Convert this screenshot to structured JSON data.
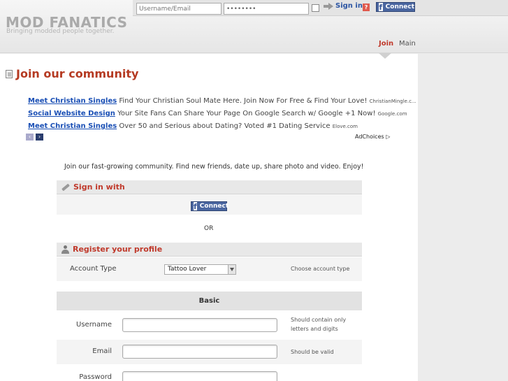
{
  "site": {
    "logo": "MOD FANATICS",
    "tagline": "Bringing modded people together."
  },
  "login": {
    "username_placeholder": "Username/Email",
    "password_value": "••••••••",
    "signin_label": "Sign in",
    "help_label": "?",
    "connect_label": "Connect"
  },
  "nav": {
    "join": "Join",
    "main": "Main"
  },
  "page": {
    "title": "Join our community"
  },
  "ads": [
    {
      "link": "Meet Christian Singles",
      "text": "Find Your Christian Soul Mate Here. Join Now For Free & Find Your Love!",
      "domain": "ChristianMingle.c..."
    },
    {
      "link": "Social Website Design",
      "text": "Your Site Fans Can Share Your Page On Google Search w/ Google +1 Now!",
      "domain": "Google.com"
    },
    {
      "link": "Meet Christian Singles",
      "text": "Over 50 and Serious about Dating? Voted #1 Dating Service",
      "domain": "Elove.com"
    }
  ],
  "adchoices": "AdChoices ▷",
  "intro": "Join our fast-growing community. Find new friends, date up, share photo and video. Enjoy!",
  "signin_section": {
    "title": "Sign in with",
    "connect_label": "Connect"
  },
  "or_text": "OR",
  "register_section": {
    "title": "Register your profile",
    "account_type_label": "Account Type",
    "account_type_value": "Tattoo Lover",
    "account_type_hint": "Choose account type",
    "basic_title": "Basic",
    "username_label": "Username",
    "username_hint_1": "Should contain only",
    "username_hint_2": "letters and digits",
    "email_label": "Email",
    "email_hint": "Should be valid",
    "password_label": "Password"
  },
  "colors": {
    "accent": "#c0392b",
    "facebook": "#4a66a0",
    "link": "#1a4fb5"
  }
}
